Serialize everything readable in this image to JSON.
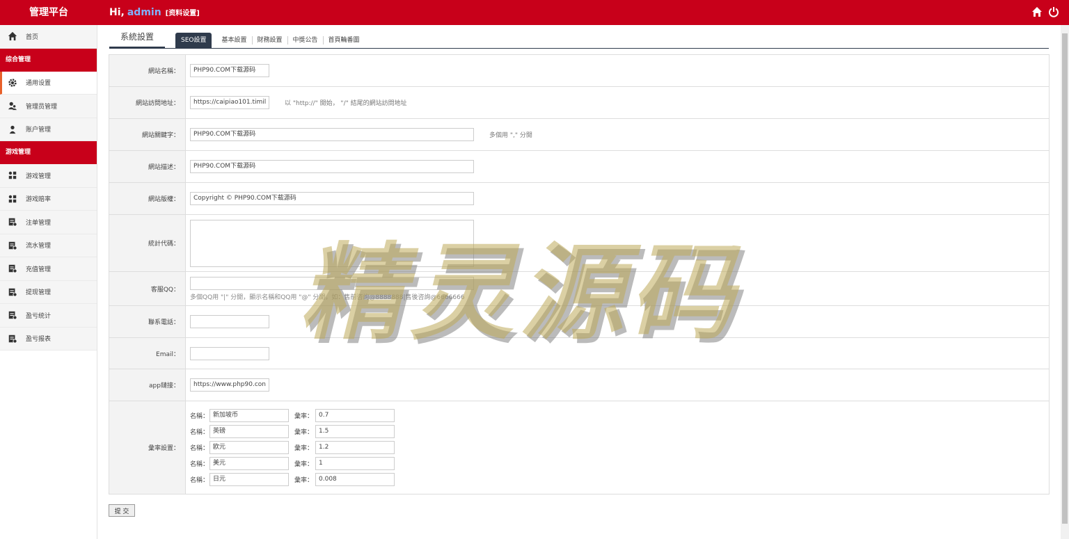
{
  "header": {
    "brand": "管理平台",
    "greeting": "Hi,",
    "username": "admin",
    "profile_link": "[资料设置]",
    "icons": [
      "home-icon",
      "power-icon"
    ]
  },
  "sidebar": {
    "home": "首页",
    "groups": [
      {
        "title": "综合管理",
        "items": [
          "通用设置",
          "管理员管理",
          "账户管理"
        ]
      },
      {
        "title": "游戏管理",
        "items": [
          "游戏管理",
          "游戏赔率",
          "注单管理",
          "流水管理",
          "充值管理",
          "提现管理",
          "盈亏统计",
          "盈亏报表"
        ]
      }
    ]
  },
  "tabs": {
    "main": "系統設置",
    "items": [
      "SEO設置",
      "基本設置",
      "財務設置",
      "中獎公告",
      "首頁輪番圖"
    ]
  },
  "form": {
    "site_name_label": "網站名稱：",
    "site_name_value": "PHP90.COM下载源码",
    "site_url_label": "網站訪問地址：",
    "site_url_value": "https://caipiao101.timil",
    "site_url_hint": "以 \"http://\" 開始， \"/\" 結尾的網站訪問地址",
    "keywords_label": "網站關鍵字：",
    "keywords_value": "PHP90.COM下载源码",
    "keywords_hint": "多個用 \",\" 分開",
    "desc_label": "網站描述：",
    "desc_value": "PHP90.COM下载源码",
    "copyright_label": "網站版權：",
    "copyright_value": "Copyright © PHP90.COM下载源码",
    "stats_label": "統計代碼：",
    "stats_value": "",
    "qq_label": "客服QQ：",
    "qq_value": "",
    "qq_hint": "多個QQ用 \"|\" 分開，顯示名稱和QQ用 \"@\" 分開，如：售前咨詢@8888888|售後咨詢@6666666",
    "phone_label": "聯系電話：",
    "phone_value": "",
    "email_label": "Email：",
    "email_value": "",
    "app_label": "app鏈接：",
    "app_value": "https://www.php90.con",
    "rate_label": "彙率設置：",
    "rate_name_label": "名稱：",
    "rate_value_label": "彙率：",
    "rates": [
      {
        "name": "新加坡币",
        "rate": "0.7"
      },
      {
        "name": "英磅",
        "rate": "1.5"
      },
      {
        "name": "欧元",
        "rate": "1.2"
      },
      {
        "name": "美元",
        "rate": "1"
      },
      {
        "name": "日元",
        "rate": "0.008"
      }
    ],
    "submit_label": "提 交"
  },
  "watermark": "精灵源码",
  "colors": {
    "brand_red": "#c8001a",
    "tab_dark": "#2f3b4c",
    "active_marker": "#e8602a"
  }
}
